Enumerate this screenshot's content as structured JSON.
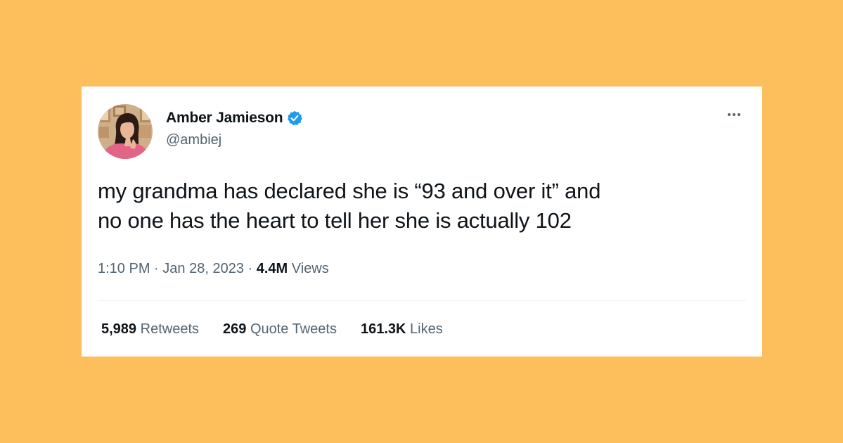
{
  "colors": {
    "background": "#FDBE5C",
    "card": "#FFFFFF",
    "verified_badge": "#1D9BF0",
    "primary_text": "#0F1419",
    "secondary_text": "#536471"
  },
  "author": {
    "display_name": "Amber Jamieson",
    "handle": "@ambiej",
    "verified": true,
    "avatar_icon": "profile-photo-avatar"
  },
  "menu": {
    "icon": "more-options-icon"
  },
  "tweet": {
    "text_lines": [
      "my grandma has declared she is “93 and over it” and",
      "no one has the heart to tell her she is actually 102"
    ],
    "time": "1:10 PM",
    "separator": "·",
    "date": "Jan 28, 2023",
    "views_count": "4.4M",
    "views_label": "Views"
  },
  "stats": [
    {
      "count": "5,989",
      "label": "Retweets"
    },
    {
      "count": "269",
      "label": "Quote Tweets"
    },
    {
      "count": "161.3K",
      "label": "Likes"
    }
  ]
}
